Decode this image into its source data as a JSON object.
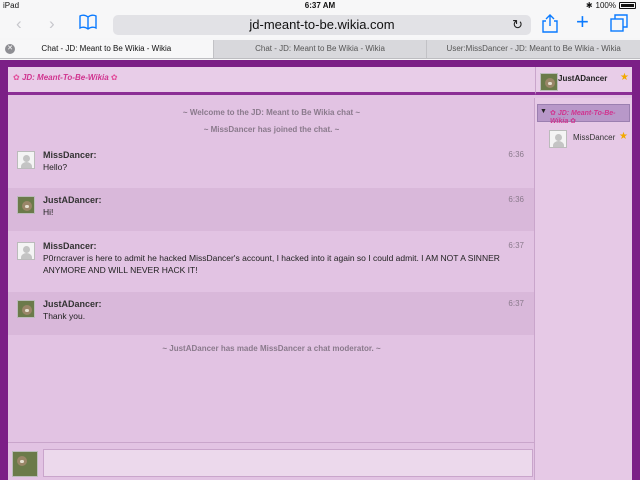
{
  "status_bar": {
    "device": "iPad",
    "time": "6:37 AM",
    "battery": "100%"
  },
  "toolbar": {
    "url": "jd-meant-to-be.wikia.com"
  },
  "tabs": [
    {
      "label": "Chat - JD: Meant to Be Wikia - Wikia"
    },
    {
      "label": "Chat - JD: Meant to Be Wikia - Wikia"
    },
    {
      "label": "User:MissDancer - JD: Meant to Be Wikia - Wikia"
    }
  ],
  "chat": {
    "logo_text": "JD: Meant-To-Be-Wikia",
    "current_user": "JustADancer",
    "alerts": {
      "welcome": "~ Welcome to the JD: Meant to Be Wikia chat ~",
      "joined": "~ MissDancer has joined the chat. ~",
      "moderator": "~ JustADancer has made MissDancer a chat moderator. ~"
    },
    "messages": [
      {
        "user": "MissDancer:",
        "text": "Hello?",
        "time": "6:36"
      },
      {
        "user": "JustADancer:",
        "text": "Hi!",
        "time": "6:36"
      },
      {
        "user": "MissDancer:",
        "text": "P0rncraver is here to admit he hacked MissDancer's account, I hacked into it again so I could admit. I AM NOT A SINNER ANYMORE AND WILL NEVER HACK IT!",
        "time": "6:37"
      },
      {
        "user": "JustADancer:",
        "text": "Thank you.",
        "time": "6:37"
      }
    ],
    "rail": {
      "room_logo": "JD: Meant-To-Be-Wikia",
      "users": [
        {
          "name": "MissDancer"
        }
      ]
    },
    "input": {
      "value": ""
    }
  },
  "icons": [
    "back-icon",
    "forward-icon",
    "bookmarks-icon",
    "reload-icon",
    "share-icon",
    "new-tab-icon",
    "tabs-icon",
    "bluetooth-icon",
    "battery-icon",
    "close-tab-icon",
    "star-icon",
    "avatar-icon"
  ]
}
